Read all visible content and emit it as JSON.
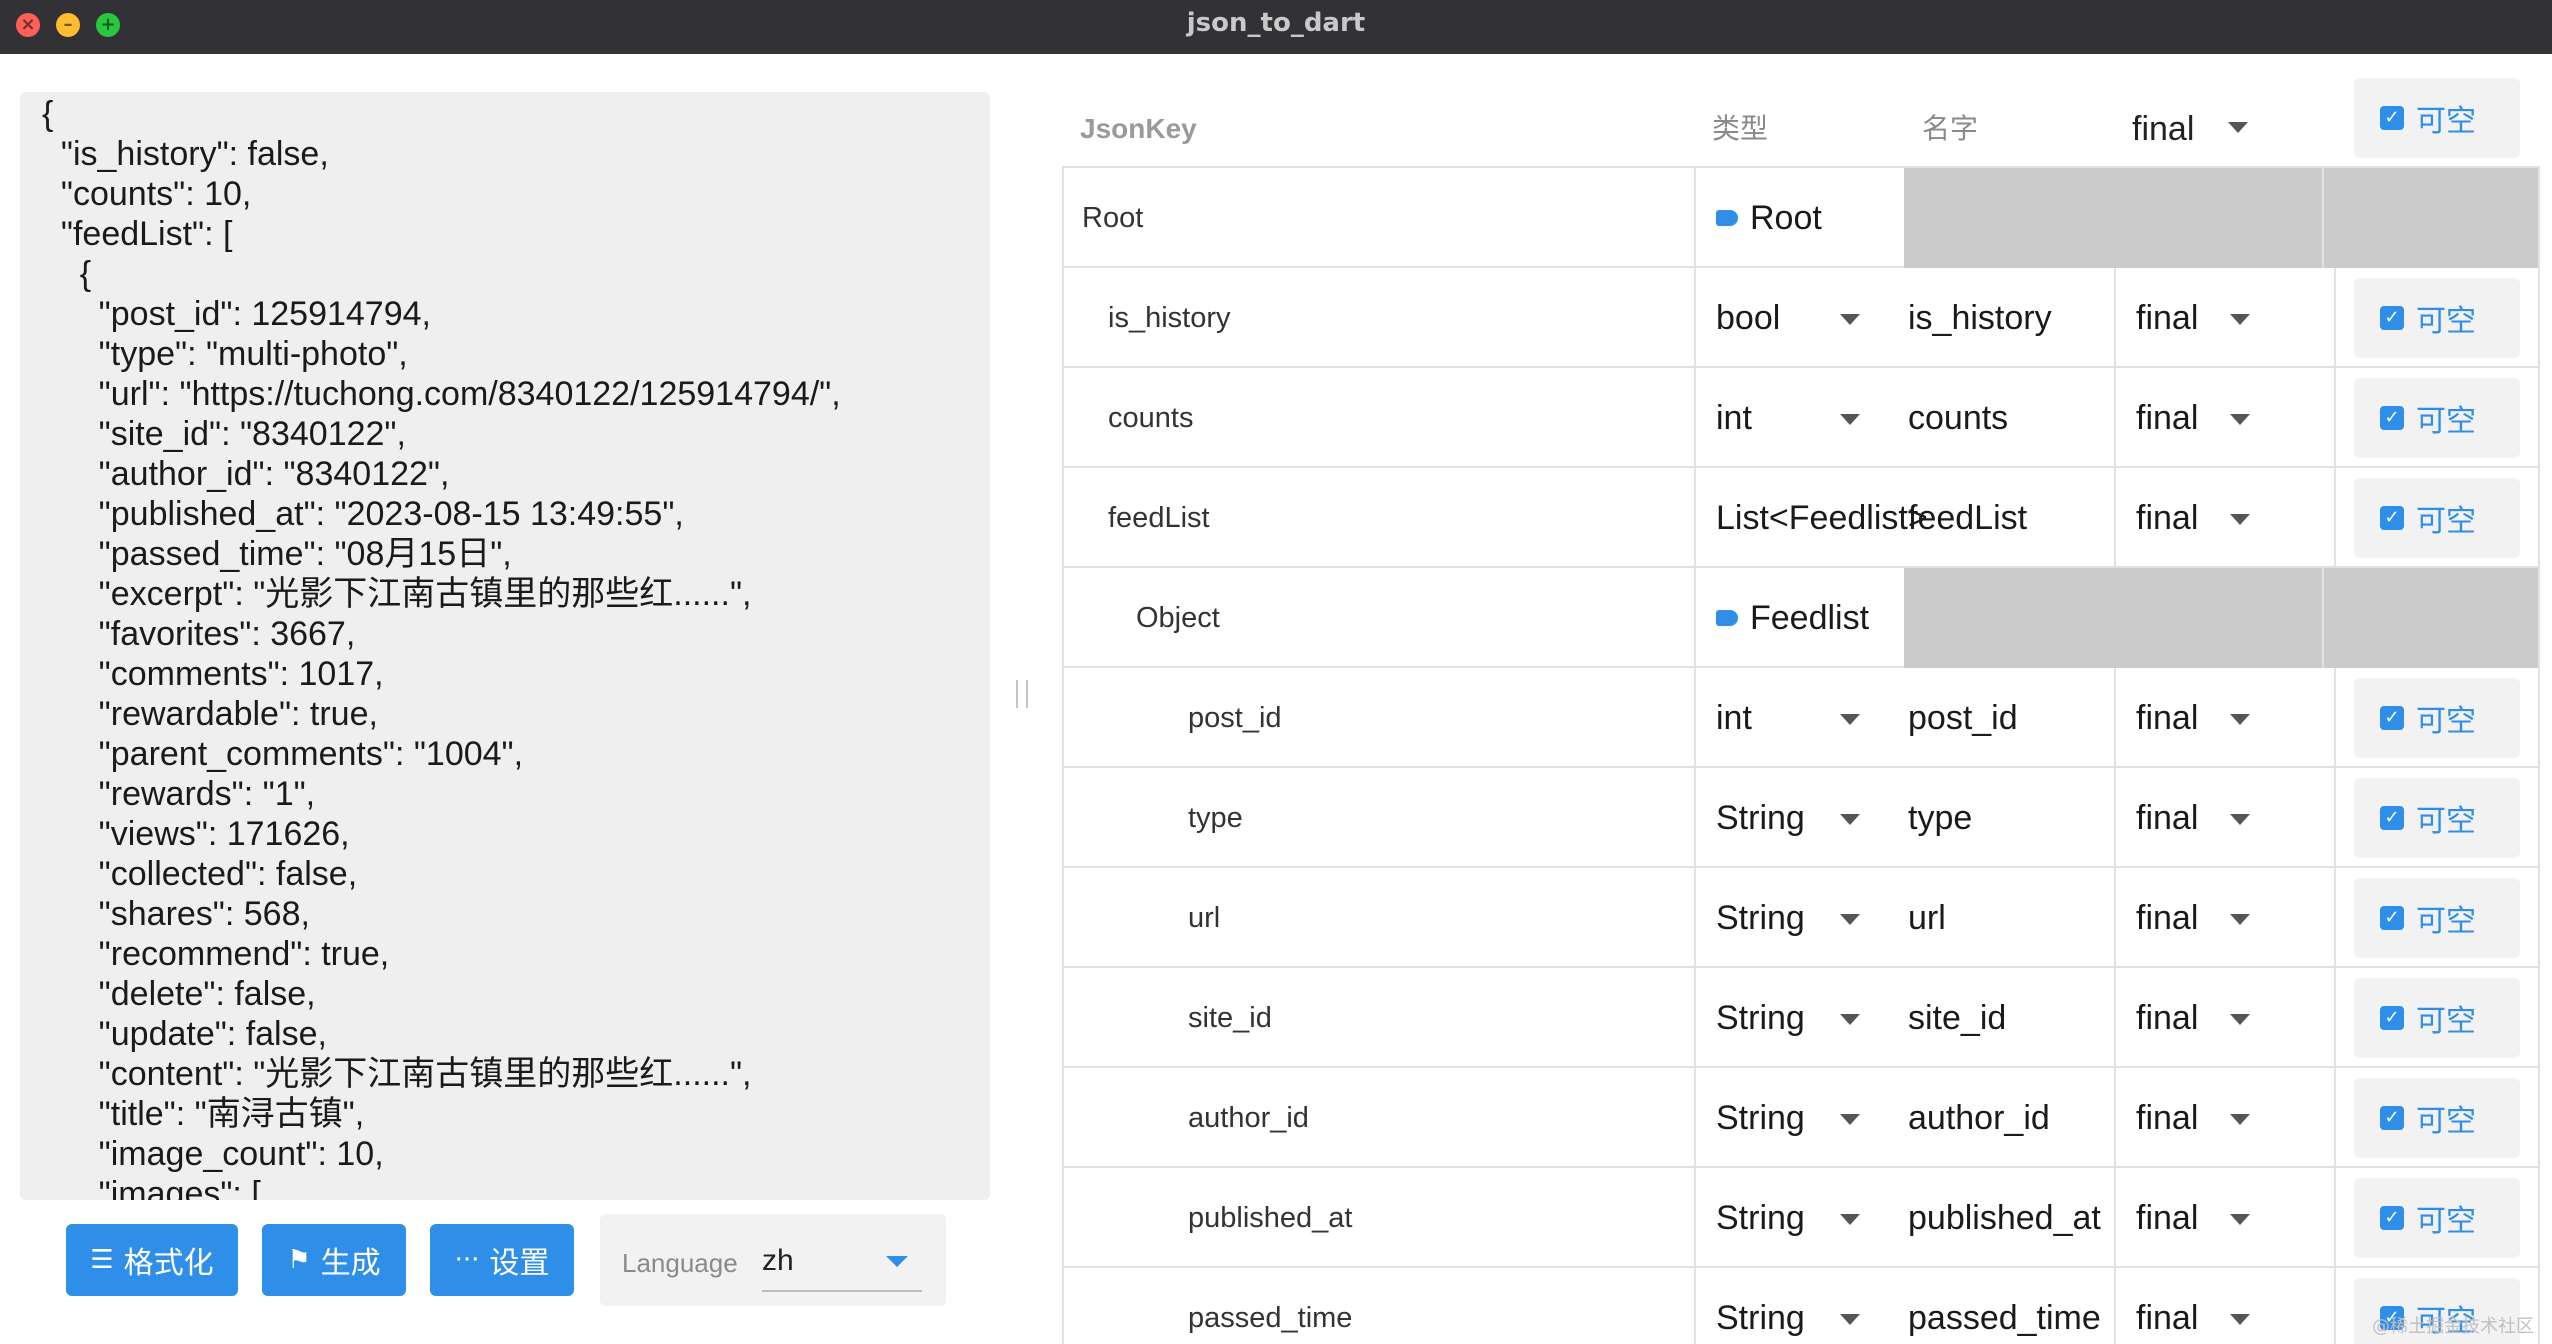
{
  "window": {
    "title": "json_to_dart"
  },
  "editor": {
    "lines": [
      "{",
      "  \"is_history\": false,",
      "  \"counts\": 10,",
      "  \"feedList\": [",
      "    {",
      "      \"post_id\": 125914794,",
      "      \"type\": \"multi-photo\",",
      "      \"url\": \"https://tuchong.com/8340122/125914794/\",",
      "      \"site_id\": \"8340122\",",
      "      \"author_id\": \"8340122\",",
      "      \"published_at\": \"2023-08-15 13:49:55\",",
      "      \"passed_time\": \"08月15日\",",
      "      \"excerpt\": \"光影下江南古镇里的那些红......\",",
      "      \"favorites\": 3667,",
      "      \"comments\": 1017,",
      "      \"rewardable\": true,",
      "      \"parent_comments\": \"1004\",",
      "      \"rewards\": \"1\",",
      "      \"views\": 171626,",
      "      \"collected\": false,",
      "      \"shares\": 568,",
      "      \"recommend\": true,",
      "      \"delete\": false,",
      "      \"update\": false,",
      "      \"content\": \"光影下江南古镇里的那些红......\",",
      "      \"title\": \"南浔古镇\",",
      "      \"image_count\": 10,",
      "      \"images\": ["
    ]
  },
  "toolbar": {
    "format_label": "格式化",
    "generate_label": "生成",
    "settings_label": "设置",
    "language_label": "Language",
    "language_value": "zh"
  },
  "header": {
    "jsonkey": "JsonKey",
    "type": "类型",
    "name": "名字",
    "final": "final",
    "nullable": "可空"
  },
  "rows": [
    {
      "kind": "class",
      "key": "Root",
      "indent": 0,
      "class_name": "Root"
    },
    {
      "kind": "field",
      "key": "is_history",
      "indent": 1,
      "type": "bool",
      "name": "is_history",
      "modifier": "final",
      "nullable": "可空"
    },
    {
      "kind": "field",
      "key": "counts",
      "indent": 1,
      "type": "int",
      "name": "counts",
      "modifier": "final",
      "nullable": "可空"
    },
    {
      "kind": "field",
      "key": "feedList",
      "indent": 1,
      "type": "List<Feedlist>",
      "name": "feedList",
      "modifier": "final",
      "nullable": "可空"
    },
    {
      "kind": "class",
      "key": "Object",
      "indent": 2,
      "class_name": "Feedlist"
    },
    {
      "kind": "field",
      "key": "post_id",
      "indent": 3,
      "type": "int",
      "name": "post_id",
      "modifier": "final",
      "nullable": "可空"
    },
    {
      "kind": "field",
      "key": "type",
      "indent": 3,
      "type": "String",
      "name": "type",
      "modifier": "final",
      "nullable": "可空"
    },
    {
      "kind": "field",
      "key": "url",
      "indent": 3,
      "type": "String",
      "name": "url",
      "modifier": "final",
      "nullable": "可空"
    },
    {
      "kind": "field",
      "key": "site_id",
      "indent": 3,
      "type": "String",
      "name": "site_id",
      "modifier": "final",
      "nullable": "可空"
    },
    {
      "kind": "field",
      "key": "author_id",
      "indent": 3,
      "type": "String",
      "name": "author_id",
      "modifier": "final",
      "nullable": "可空"
    },
    {
      "kind": "field",
      "key": "published_at",
      "indent": 3,
      "type": "String",
      "name": "published_at",
      "modifier": "final",
      "nullable": "可空"
    },
    {
      "kind": "field",
      "key": "passed_time",
      "indent": 3,
      "type": "String",
      "name": "passed_time",
      "modifier": "final",
      "nullable": "可空"
    }
  ],
  "watermark": "@稀土掘金技术社区",
  "colors": {
    "accent": "#2f8fe8",
    "titlebar": "#323236",
    "class_row_fill": "#cbcbcb"
  }
}
